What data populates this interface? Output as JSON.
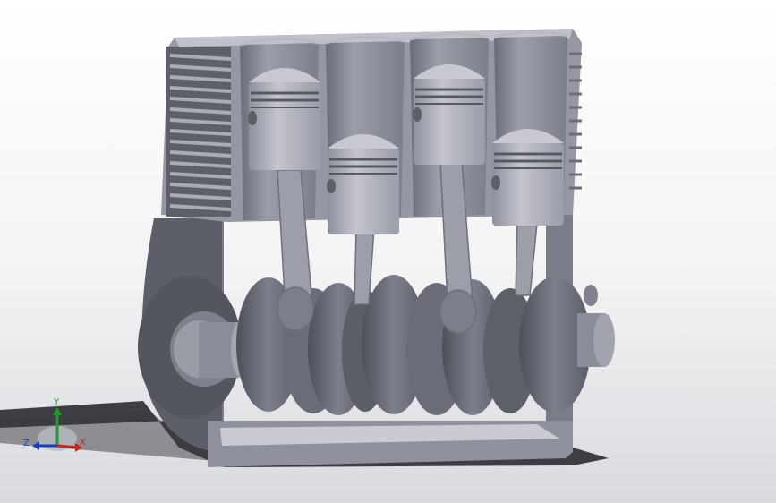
{
  "viewport": {
    "background_top": "#ffffff",
    "background_bottom": "#dcdde0",
    "model_name": "",
    "model_colors": {
      "metal_light": "#b7b8c3",
      "metal_mid": "#8e909c",
      "metal_dark": "#5f616c",
      "metal_deep": "#3f414a",
      "shadow": "#3c3c42"
    }
  },
  "triad": {
    "x_label": "X",
    "y_label": "Y",
    "z_label": "Z",
    "x_color": "#c8231e",
    "y_color": "#1e9a2c",
    "z_color": "#1c3fb8"
  }
}
